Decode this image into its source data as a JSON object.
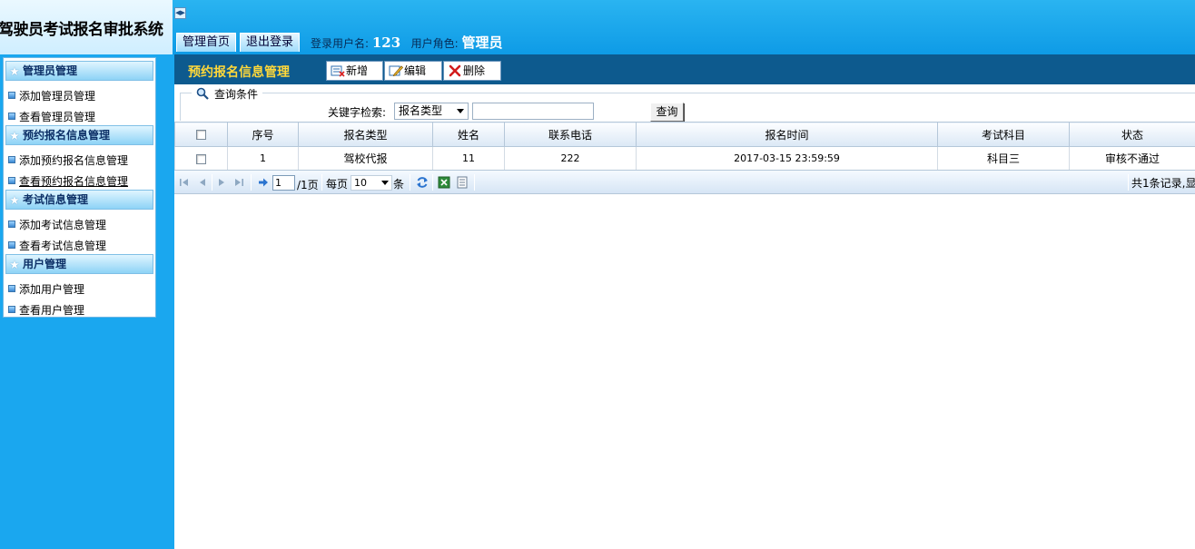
{
  "app": {
    "title": "驾驶员考试报名审批系统"
  },
  "header": {
    "home_label": "管理首页",
    "logout_label": "退出登录",
    "username_label": "登录用户名:",
    "username": "123",
    "role_label": "用户角色:",
    "role": "管理员"
  },
  "sidebar": {
    "groups": [
      {
        "title": "管理员管理",
        "items": [
          "添加管理员管理",
          "查看管理员管理"
        ]
      },
      {
        "title": "预约报名信息管理",
        "items": [
          "添加预约报名信息管理",
          "查看预约报名信息管理"
        ]
      },
      {
        "title": "考试信息管理",
        "items": [
          "添加考试信息管理",
          "查看考试信息管理"
        ]
      },
      {
        "title": "用户管理",
        "items": [
          "添加用户管理",
          "查看用户管理"
        ]
      }
    ]
  },
  "main": {
    "title": "预约报名信息管理",
    "toolbar": {
      "add_label": "新增",
      "edit_label": "编辑",
      "delete_label": "删除"
    },
    "query": {
      "legend": "查询条件",
      "keyword_label": "关键字检索:",
      "keyword_field_selected": "报名类型",
      "keyword_value": "",
      "search_label": "查询"
    },
    "table": {
      "columns": [
        "序号",
        "报名类型",
        "姓名",
        "联系电话",
        "报名时间",
        "考试科目",
        "状态"
      ],
      "rows": [
        {
          "index": "1",
          "type": "驾校代报",
          "name": "11",
          "phone": "222",
          "time": "2017-03-15 23:59:59",
          "subject": "科目三",
          "status": "审核不通过"
        }
      ]
    },
    "pager": {
      "current_page": "1",
      "total_pages_text": "/1页",
      "per_page_label": "每页",
      "per_page_value": "10",
      "per_page_unit": "条",
      "summary": "共1条记录,显"
    }
  }
}
